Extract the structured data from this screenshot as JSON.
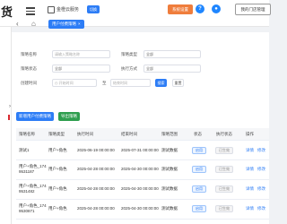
{
  "header": {
    "brand": "货",
    "store_name": "金橙云服务",
    "switch_label": "切换",
    "system_label": "系统设置",
    "help_icon": "help-icon",
    "notice_icon": "bell-icon",
    "shop_button": "我的门店管理"
  },
  "tabs": {
    "active": "用户付费策略",
    "close": "×"
  },
  "filters": {
    "strategy_name": {
      "label": "策略名称",
      "placeholder": "请输入策略名称"
    },
    "strategy_type": {
      "label": "策略类型",
      "value": "全部"
    },
    "strategy_status": {
      "label": "策略状态",
      "value": "全部"
    },
    "exec_type": {
      "label": "执行方式",
      "value": "全部"
    },
    "time": {
      "label": "创建时间",
      "start_placeholder": "开始时间",
      "to": "至",
      "end_placeholder": "结束时间"
    },
    "search_label": "搜索",
    "reset_label": "重置"
  },
  "actions": {
    "new_label": "新增用户付费策略",
    "export_label": "导出策略"
  },
  "table": {
    "columns": [
      "策略名称",
      "策略类型",
      "执行时间",
      "结束时间",
      "策略范围",
      "状态",
      "执行状态",
      "操作"
    ],
    "rows": [
      {
        "name": [
          "测试1"
        ],
        "type": "用户+角色",
        "exec_time": "2025-06-19 00:00:00",
        "end_time": "2025-07-31 00:00:00",
        "scope": "测试数据",
        "status_tag": "启用",
        "exec_status": "已生效",
        "actions": [
          "详情",
          "修改"
        ]
      },
      {
        "name": [
          "用户+角色_174",
          "9531187"
        ],
        "type": "用户+角色",
        "exec_time": "2025-04-28 00:00:00",
        "end_time": "2025-04-30 00:00:00",
        "scope": "测试数据",
        "status_tag": "启用",
        "exec_status": "已生效",
        "actions": [
          "详情",
          "修改"
        ]
      },
      {
        "name": [
          "用户+角色_174",
          "9531482"
        ],
        "type": "用户+角色",
        "exec_time": "2025-04-28 00:00:00",
        "end_time": "2025-04-30 00:00:00",
        "scope": "测试数据",
        "status_tag": "启用",
        "exec_status": "已生效",
        "actions": [
          "详情",
          "修改"
        ]
      },
      {
        "name": [
          "用户+角色_174",
          "9530871"
        ],
        "type": "用户+角色",
        "exec_time": "2025-04-28 00:00:00",
        "end_time": "2025-04-30 00:00:00",
        "scope": "测试数据",
        "status_tag": "启用",
        "exec_status": "已生效",
        "actions": [
          "详情",
          "修改"
        ]
      }
    ]
  }
}
